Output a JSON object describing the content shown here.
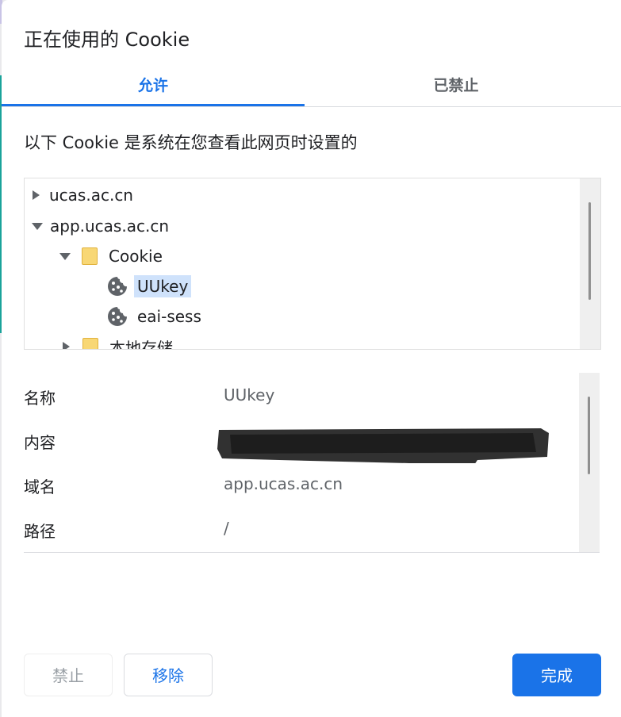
{
  "dialog": {
    "title": "正在使用的 Cookie",
    "tabs": [
      {
        "label": "允许",
        "active": true
      },
      {
        "label": "已禁止",
        "active": false
      }
    ],
    "description": "以下 Cookie 是系统在您查看此网页时设置的"
  },
  "tree": {
    "items": [
      {
        "label": "ucas.ac.cn",
        "expanded": false,
        "icon": "triangle-right-icon"
      },
      {
        "label": "app.ucas.ac.cn",
        "expanded": true,
        "icon": "triangle-down-icon"
      },
      {
        "label": "Cookie",
        "expanded": true,
        "icon": "folder-icon"
      },
      {
        "label": "UUkey",
        "selected": true,
        "icon": "cookie-icon"
      },
      {
        "label": "eai-sess",
        "selected": false,
        "icon": "cookie-icon"
      },
      {
        "label": "本地存储",
        "expanded": false,
        "icon": "folder-icon"
      }
    ]
  },
  "details": {
    "rows": [
      {
        "label": "名称",
        "value": "UUkey"
      },
      {
        "label": "内容",
        "value": ""
      },
      {
        "label": "域名",
        "value": "app.ucas.ac.cn"
      },
      {
        "label": "路径",
        "value": "/"
      }
    ]
  },
  "buttons": {
    "block": "禁止",
    "remove": "移除",
    "done": "完成"
  },
  "colors": {
    "accent": "#1a73e8",
    "selection": "#cfe2fb",
    "folder": "#f8d775"
  }
}
